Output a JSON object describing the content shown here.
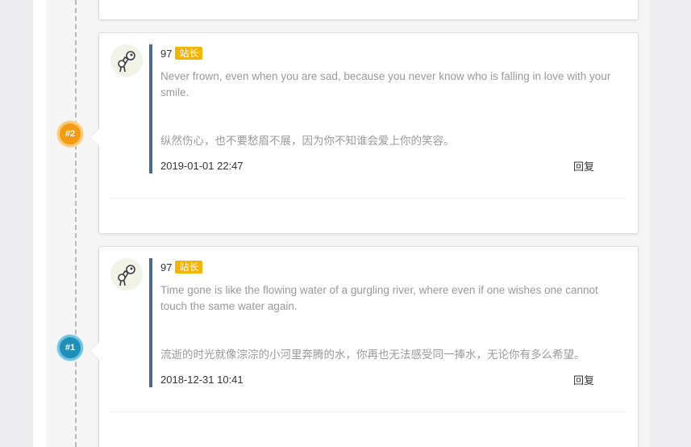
{
  "comments": [
    {
      "badge": "#2",
      "badge_color": "#f39c12",
      "username": "97",
      "role": "站长",
      "text_en": "Never frown, even when you are sad, because you never know who is falling in love with your smile.",
      "text_zh": "纵然伤心，也不要愁眉不展，因为你不知谁会爱上你的笑容。",
      "date": "2019-01-01 22:47",
      "reply_label": "回复"
    },
    {
      "badge": "#1",
      "badge_color": "#1f8fb8",
      "username": "97",
      "role": "站长",
      "text_en": "Time gone is like the flowing water of a gurgling river, where even if one wishes one cannot touch the same water again.",
      "text_zh": "流逝的时光就像淙淙的小河里奔腾的水，你再也无法感受同一捧水，无论你有多么希望。",
      "date": "2018-12-31 10:41",
      "reply_label": "回复"
    }
  ],
  "icons": {
    "avatar": "avatar-image",
    "role_color": "#f5b400",
    "quote_bar_color": "#4a6a9a"
  }
}
